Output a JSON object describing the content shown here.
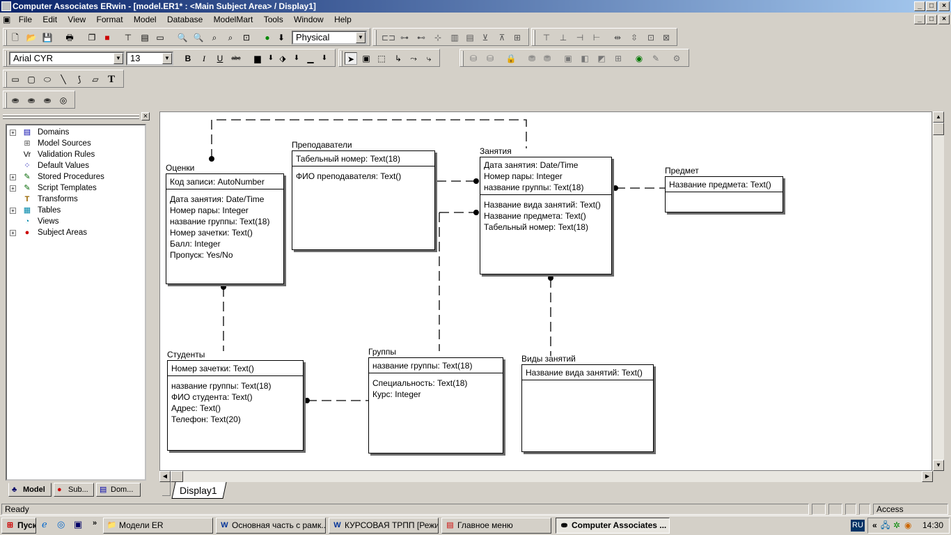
{
  "window": {
    "title": "Computer Associates ERwin - [model.ER1* : <Main Subject Area> / Display1]"
  },
  "menu": [
    "File",
    "Edit",
    "View",
    "Format",
    "Model",
    "Database",
    "ModelMart",
    "Tools",
    "Window",
    "Help"
  ],
  "toolbar": {
    "model_type": "Physical",
    "font_name": "Arial CYR",
    "font_size": "13"
  },
  "tree": {
    "items": [
      {
        "label": "Domains",
        "icon": "domains-icon",
        "expandable": true
      },
      {
        "label": "Model Sources",
        "icon": "model-sources-icon",
        "expandable": false
      },
      {
        "label": "Validation Rules",
        "icon": "validation-rules-icon",
        "expandable": false
      },
      {
        "label": "Default Values",
        "icon": "default-values-icon",
        "expandable": false
      },
      {
        "label": "Stored Procedures",
        "icon": "stored-procedures-icon",
        "expandable": true
      },
      {
        "label": "Script Templates",
        "icon": "script-templates-icon",
        "expandable": true
      },
      {
        "label": "Transforms",
        "icon": "transforms-icon",
        "expandable": false
      },
      {
        "label": "Tables",
        "icon": "tables-icon",
        "expandable": true
      },
      {
        "label": "Views",
        "icon": "views-icon",
        "expandable": false
      },
      {
        "label": "Subject Areas",
        "icon": "subject-areas-icon",
        "expandable": true
      }
    ]
  },
  "left_tabs": [
    "Model",
    "Sub...",
    "Dom..."
  ],
  "display_tab": "Display1",
  "entities": {
    "ocenki": {
      "name": "Оценки",
      "keys": [
        "Код записи: AutoNumber"
      ],
      "attrs": [
        "Дата занятия: Date/Time",
        "Номер пары: Integer",
        "название группы: Text(18)",
        "Номер зачетки: Text()",
        "Балл: Integer",
        "Пропуск: Yes/No"
      ]
    },
    "prepod": {
      "name": "Преподаватели",
      "keys": [
        "Табельный номер: Text(18)"
      ],
      "attrs": [
        "ФИО преподавателя: Text()"
      ]
    },
    "zanyatiya": {
      "name": "Занятия",
      "keys": [
        "Дата занятия: Date/Time",
        "Номер пары: Integer",
        "название группы: Text(18)"
      ],
      "attrs": [
        "Название вида занятий: Text()",
        "Название предмета: Text()",
        "Табельный номер: Text(18)"
      ]
    },
    "predmet": {
      "name": "Предмет",
      "keys": [
        "Название предмета: Text()"
      ],
      "attrs": []
    },
    "studenty": {
      "name": "Студенты",
      "keys": [
        "Номер зачетки: Text()"
      ],
      "attrs": [
        "название группы: Text(18)",
        "ФИО студента: Text()",
        "Адрес: Text()",
        "Телефон: Text(20)"
      ]
    },
    "gruppy": {
      "name": "Группы",
      "keys": [
        "название группы: Text(18)"
      ],
      "attrs": [
        "Специальность: Text(18)",
        "Курс: Integer"
      ]
    },
    "vidy": {
      "name": "Виды занятий",
      "keys": [
        "Название вида занятий: Text()"
      ],
      "attrs": []
    }
  },
  "status": {
    "text": "Ready",
    "access": "Access"
  },
  "taskbar": {
    "start": "Пуск",
    "tasks": [
      "Модели ER",
      "Основная часть с рамк...",
      "КУРСОВАЯ ТРПП [Режи...",
      "Главное меню",
      "Computer Associates ..."
    ],
    "lang": "RU",
    "clock": "14:30"
  }
}
